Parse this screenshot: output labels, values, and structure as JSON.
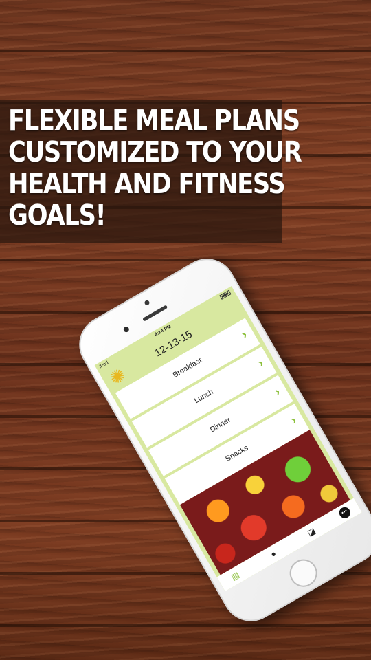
{
  "headline": {
    "lines": [
      "FLEXIBLE MEAL PLANS",
      "CUSTOMIZED  TO YOUR",
      "HEALTH AND FITNESS",
      "GOALS!"
    ]
  },
  "phone": {
    "status": {
      "carrier": "iPod",
      "time": "4:14 PM"
    },
    "date": "12-13-15",
    "meals": [
      {
        "label": "Breakfast"
      },
      {
        "label": "Lunch"
      },
      {
        "label": "Dinner"
      },
      {
        "label": "Snacks"
      }
    ],
    "tabs": [
      "meal-plan-icon",
      "profile-icon",
      "basket-icon",
      "more-icon"
    ],
    "colors": {
      "screen_bg": "#d8e8a0",
      "accent": "#8bbf3a"
    }
  }
}
